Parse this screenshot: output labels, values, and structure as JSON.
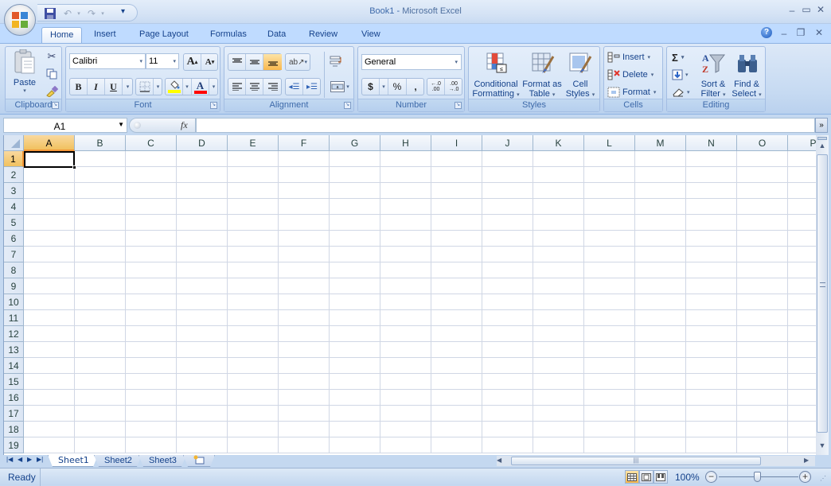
{
  "window": {
    "title_doc": "Book1",
    "title_sep": " - ",
    "title_app": "Microsoft Excel",
    "minimize": "–",
    "maximize": "▭",
    "close": "✕",
    "wb_minimize": "–",
    "wb_restore": "❐",
    "wb_close": "✕",
    "help": "?"
  },
  "quick_access": {
    "save_icon": "💾",
    "undo_icon": "↶",
    "redo_icon": "↷",
    "customize_icon": "▾"
  },
  "tabs": [
    {
      "label": "Home",
      "active": true
    },
    {
      "label": "Insert"
    },
    {
      "label": "Page Layout"
    },
    {
      "label": "Formulas"
    },
    {
      "label": "Data"
    },
    {
      "label": "Review"
    },
    {
      "label": "View"
    }
  ],
  "ribbon": {
    "clipboard": {
      "label": "Clipboard",
      "paste": "Paste"
    },
    "font": {
      "label": "Font",
      "font_name": "Calibri",
      "font_size": "11",
      "grow": "A",
      "shrink": "A",
      "bold": "B",
      "italic": "I",
      "underline": "U",
      "fill_color": "#ffff00",
      "font_color": "#ff0000",
      "font_color_glyph": "A"
    },
    "alignment": {
      "label": "Alignment"
    },
    "number": {
      "label": "Number",
      "format": "General",
      "currency": "$",
      "percent": "%",
      "comma": ",",
      "inc_decimal": "←.0",
      "dec_decimal": ".00"
    },
    "styles": {
      "label": "Styles",
      "conditional_1": "Conditional",
      "conditional_2": "Formatting",
      "table_1": "Format as",
      "table_2": "Table",
      "cell_1": "Cell",
      "cell_2": "Styles"
    },
    "cells": {
      "label": "Cells",
      "insert": "Insert",
      "delete": "Delete",
      "format": "Format"
    },
    "editing": {
      "label": "Editing",
      "sigma": "Σ",
      "sort_1": "Sort &",
      "sort_2": "Filter",
      "find_1": "Find &",
      "find_2": "Select"
    }
  },
  "formula_bar": {
    "name_box": "A1",
    "fx": "fx",
    "value": ""
  },
  "grid": {
    "columns": [
      "A",
      "B",
      "C",
      "D",
      "E",
      "F",
      "G",
      "H",
      "I",
      "J",
      "K",
      "L",
      "M",
      "N",
      "O",
      "P"
    ],
    "rows": [
      "1",
      "2",
      "3",
      "4",
      "5",
      "6",
      "7",
      "8",
      "9",
      "10",
      "11",
      "12",
      "13",
      "14",
      "15",
      "16",
      "17",
      "18",
      "19"
    ],
    "selected_cell": "A1"
  },
  "sheets": [
    {
      "label": "Sheet1",
      "active": true
    },
    {
      "label": "Sheet2"
    },
    {
      "label": "Sheet3"
    }
  ],
  "status": {
    "text": "Ready",
    "zoom": "100%",
    "zoom_out": "−",
    "zoom_in": "+"
  }
}
